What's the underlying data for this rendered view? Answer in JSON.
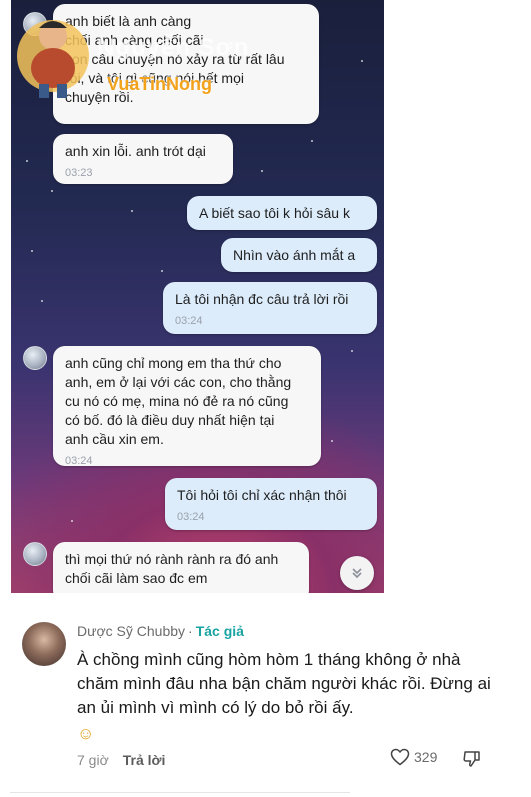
{
  "watermark": {
    "title": "Nguyễn Sơn",
    "subtitle": "VuaTinNong"
  },
  "chat": {
    "messages": [
      {
        "dir": "in",
        "text": "anh biết là anh càng\nchối anh càng chối cãi\ncon câu chuyện nó xảy ra từ rất lâu\nrồi, và tôi gì cũng nói hết mọi\nchuyện rồi.",
        "time": ""
      },
      {
        "dir": "in",
        "text": "anh xin lỗi. anh trót dại",
        "time": "03:23"
      },
      {
        "dir": "out",
        "text": "A biết sao tôi k hỏi sâu k",
        "time": ""
      },
      {
        "dir": "out",
        "text": "Nhìn vào ánh mắt a",
        "time": ""
      },
      {
        "dir": "out",
        "text": "Là tôi nhận đc câu trả lời rồi",
        "time": "03:24"
      },
      {
        "dir": "in",
        "text": "anh cũng chỉ mong em tha thứ cho\nanh, em ở lại với các con, cho thằng\ncu nó có mẹ, mina nó đẻ ra nó cũng\ncó bố. đó là điều duy nhất hiện tại\nanh cầu xin em.",
        "time": "03:24"
      },
      {
        "dir": "out",
        "text": "Tôi hỏi tôi chỉ xác nhận thôi",
        "time": "03:24"
      },
      {
        "dir": "in",
        "text": "thì mọi thứ nó rành rành ra đó anh\nchối cãi làm sao đc em",
        "time": ""
      }
    ]
  },
  "comment": {
    "author": "Dược Sỹ Chubby",
    "separator": "·",
    "badge": "Tác giả",
    "body": "À chồng mình cũng hòm hòm 1 tháng không ở nhà chăm mình đâu nha bận chăm người khác rồi. Đừng ai an ủi mình vì mình có lý do bỏ rồi ấy.",
    "emoji": "☺",
    "time": "7 giờ",
    "reply_label": "Trả lời",
    "like_count": "329"
  },
  "icons": {
    "scroll_down": "chevron-double-down-icon",
    "like": "heart-outline-icon",
    "dislike": "thumb-down-outline-icon"
  }
}
